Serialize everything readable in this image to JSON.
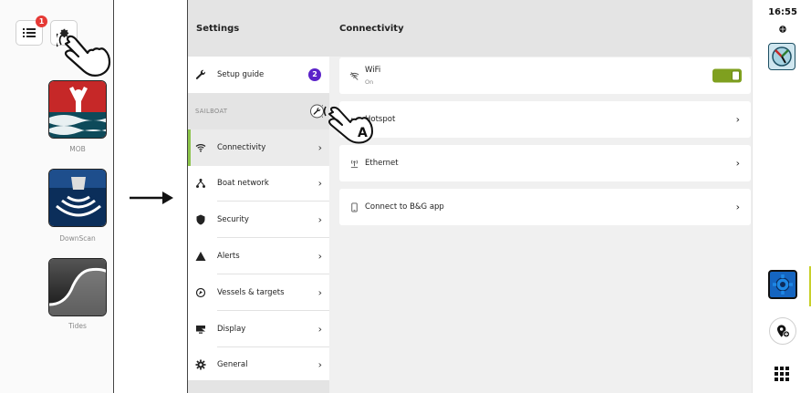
{
  "left_panel": {
    "menu_badge_count": "1",
    "apps": [
      {
        "label": "MOB",
        "icon": "mob-icon"
      },
      {
        "label": "DownScan",
        "icon": "downscan-icon"
      },
      {
        "label": "Tides",
        "icon": "tides-icon"
      }
    ]
  },
  "settings": {
    "title": "Settings",
    "setup_guide": {
      "label": "Setup guide",
      "badge": "2"
    },
    "section_label": "SAILBOAT",
    "items": [
      {
        "label": "Connectivity",
        "icon": "wifi-icon",
        "active": true
      },
      {
        "label": "Boat network",
        "icon": "network-icon"
      },
      {
        "label": "Security",
        "icon": "shield-icon"
      },
      {
        "label": "Alerts",
        "icon": "warning-icon"
      },
      {
        "label": "Vessels & targets",
        "icon": "target-icon"
      },
      {
        "label": "Display",
        "icon": "display-icon"
      },
      {
        "label": "General",
        "icon": "gear-icon"
      }
    ]
  },
  "connectivity": {
    "title": "Connectivity",
    "wifi": {
      "label": "WiFi",
      "status": "On",
      "enabled": true
    },
    "hotspot": {
      "label": "Hotspot"
    },
    "ethernet": {
      "label": "Ethernet"
    },
    "connect_app": {
      "label": "Connect to B&G app"
    }
  },
  "status": {
    "time": "16:55"
  },
  "callout": {
    "letter": "A"
  },
  "colors": {
    "accent_green": "#8bc34a",
    "toggle_green": "#7fa01f",
    "badge_red": "#e53935",
    "badge_purple": "#5b22c9",
    "settings_blue": "#1565c0"
  }
}
